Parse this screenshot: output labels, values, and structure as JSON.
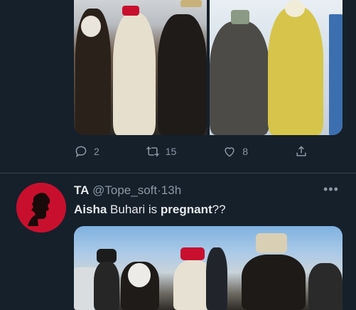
{
  "tweet1": {
    "replies": "2",
    "retweets": "15",
    "likes": "8"
  },
  "tweet2": {
    "display_name": "TA",
    "handle": "@Tope_soft",
    "separator": "·",
    "time": "13h",
    "more": "•••",
    "text_part1": "Aisha",
    "text_part2": " Buhari is ",
    "text_part3": "pregnant",
    "text_part4": "??"
  },
  "colors": {
    "background": "#15202b",
    "divider": "#38444d",
    "secondary_text": "#8b98a5",
    "avatar_red": "#c8102e"
  },
  "icons": [
    "reply-icon",
    "retweet-icon",
    "like-icon",
    "share-icon",
    "more-icon"
  ]
}
